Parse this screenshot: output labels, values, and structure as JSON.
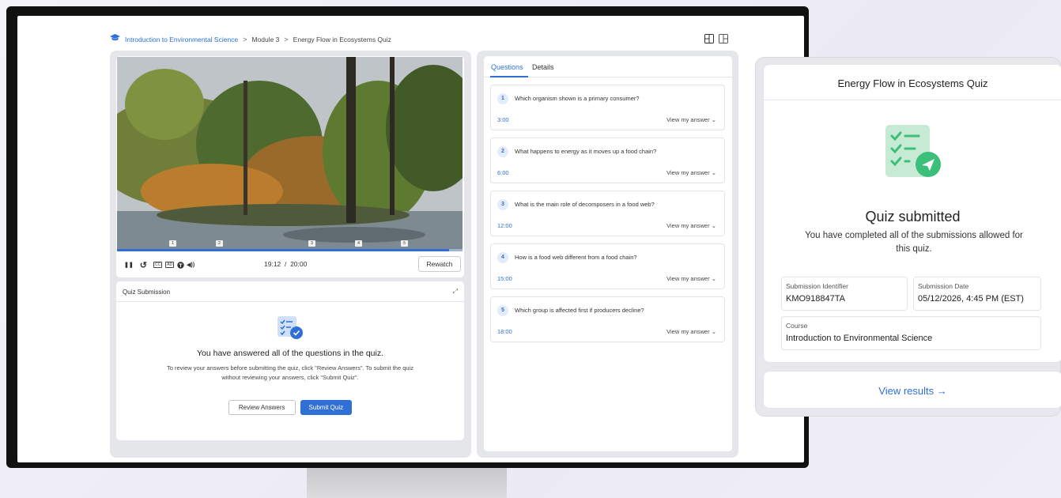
{
  "breadcrumb": {
    "course": "Introduction to Environmental Science",
    "separator": ">",
    "module": "Module 3",
    "quiz": "Energy Flow in Ecosystems Quiz"
  },
  "video": {
    "time_display": "19:12  /  20:00",
    "progress": 0.96,
    "chapters": [
      "1",
      "2",
      "3",
      "4",
      "5"
    ],
    "rewatch_label": "Rewatch",
    "controls": {
      "pause": "❚❚",
      "replay": "↺",
      "cc": "CC",
      "ad": "AD",
      "audio": "◀))"
    }
  },
  "quiz_submission": {
    "heading": "Quiz Submission",
    "title": "You have answered all of the questions in the quiz.",
    "description": "To review your answers before submitting the quiz, click \"Review Answers\". To submit the quiz without reviewing your answers, click \"Submit Quiz\".",
    "review_label": "Review Answers",
    "submit_label": "Submit Quiz"
  },
  "tabs": {
    "questions": "Questions",
    "details": "Details"
  },
  "questions": [
    {
      "num": "1",
      "text": "Which organism shown is a primary consumer?",
      "time": "3:00",
      "view": "View my answer"
    },
    {
      "num": "2",
      "text": "What happens to energy as it moves up a food chain?",
      "time": "6:00",
      "view": "View my answer"
    },
    {
      "num": "3",
      "text": "What is the main role of decomposers in a food web?",
      "time": "12:00",
      "view": "View my answer"
    },
    {
      "num": "4",
      "text": "How is a food web different from a food chain?",
      "time": "15:00",
      "view": "View my answer"
    },
    {
      "num": "5",
      "text": "Which group is affected first if producers decline?",
      "time": "18:00",
      "view": "View my answer"
    }
  ],
  "overlay": {
    "title": "Energy Flow in Ecosystems Quiz",
    "heading": "Quiz submitted",
    "subtext": "You have completed all of the submissions allowed for this quiz.",
    "submission_id_label": "Submission Identifier",
    "submission_id": "KMO918847TA",
    "submission_date_label": "Submission Date",
    "submission_date": "05/12/2026, 4:45 PM (EST)",
    "course_label": "Course",
    "course": "Introduction to Environmental Science",
    "view_results": "View results →"
  },
  "colors": {
    "accent": "#2f6fd6",
    "success": "#3bbf7a"
  }
}
